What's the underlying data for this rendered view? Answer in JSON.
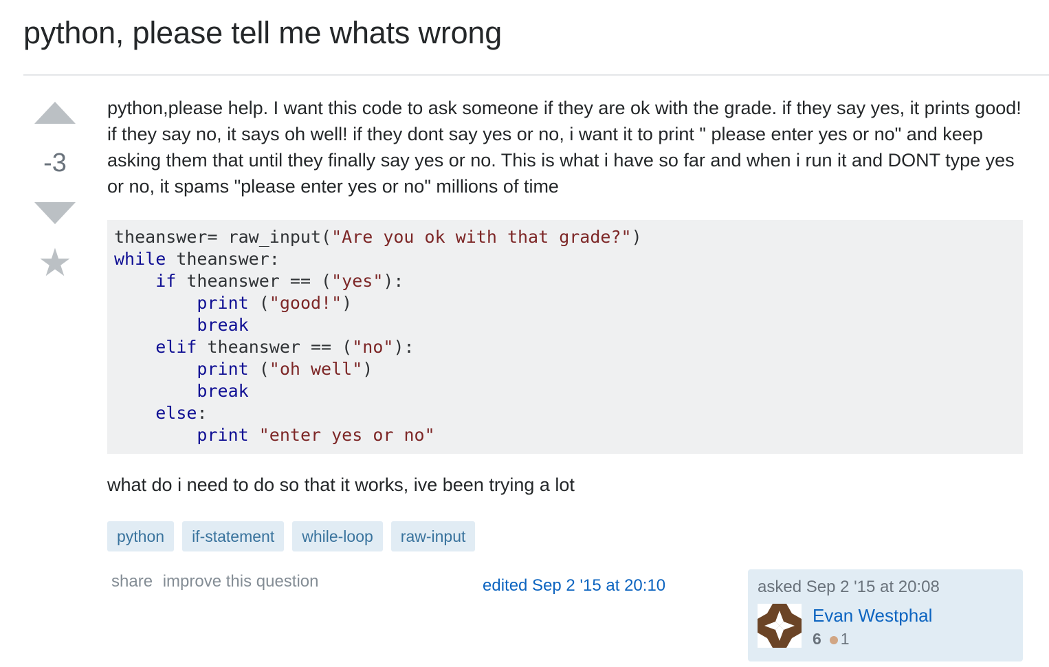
{
  "question": {
    "title": "python, please tell me whats wrong",
    "vote_count": "-3",
    "body_paragraph_1": "python,please help. I want this code to ask someone if they are ok with the grade. if they say yes, it prints good! if they say no, it says oh well! if they dont say yes or no, i want it to print \" please enter yes or no\" and keep asking them that until they finally say yes or no. This is what i have so far and when i run it and DONT type yes or no, it spams \"please enter yes or no\" millions of time",
    "body_paragraph_2": "what do i need to do so that it works, ive been trying a lot",
    "code_lines": [
      "theanswer= raw_input(\"Are you ok with that grade?\")",
      "while theanswer:",
      "    if theanswer == (\"yes\"):",
      "        print (\"good!\")",
      "        break",
      "    elif theanswer == (\"no\"):",
      "        print (\"oh well\")",
      "        break",
      "    else:",
      "        print \"enter yes or no\""
    ]
  },
  "tags": [
    "python",
    "if-statement",
    "while-loop",
    "raw-input"
  ],
  "post_menu": {
    "share": "share",
    "improve": "improve this question"
  },
  "edited": "edited Sep 2 '15 at 20:10",
  "owner": {
    "asked": "asked Sep 2 '15 at 20:08",
    "name": "Evan Westphal",
    "reputation": "6",
    "bronze_badges": "1"
  },
  "colors": {
    "accent_link": "#0c64c0",
    "tag_bg": "#e1ecf4",
    "tag_text": "#39739d",
    "code_bg": "#eff0f1",
    "keyword": "#101094",
    "string": "#7d2727",
    "bronze": "#d1a684"
  }
}
